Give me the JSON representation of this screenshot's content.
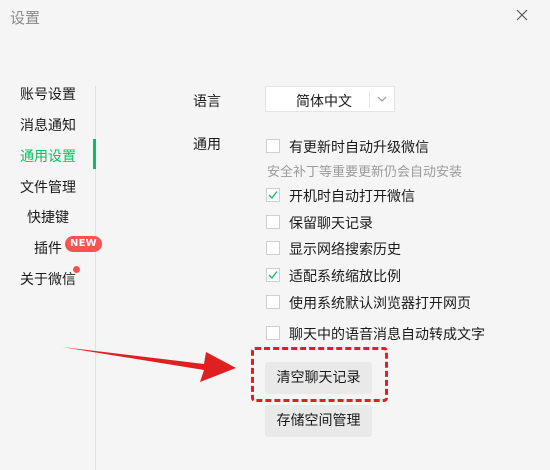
{
  "window": {
    "title": "设置"
  },
  "sidebar": {
    "items": [
      {
        "label": "账号设置"
      },
      {
        "label": "消息通知"
      },
      {
        "label": "通用设置"
      },
      {
        "label": "文件管理"
      },
      {
        "label": "快捷键"
      },
      {
        "label": "插件",
        "badge": "NEW"
      },
      {
        "label": "关于微信"
      }
    ]
  },
  "language": {
    "label": "语言",
    "value": "简体中文"
  },
  "general": {
    "label": "通用",
    "options": [
      {
        "label": "有更新时自动升级微信",
        "checked": false
      },
      {
        "label": "开机时自动打开微信",
        "checked": true
      },
      {
        "label": "保留聊天记录",
        "checked": false
      },
      {
        "label": "显示网络搜索历史",
        "checked": false
      },
      {
        "label": "适配系统缩放比例",
        "checked": true
      },
      {
        "label": "使用系统默认浏览器打开网页",
        "checked": false
      },
      {
        "label": "聊天中的语音消息自动转成文字",
        "checked": false
      }
    ],
    "hint": "安全补丁等重要更新仍会自动安装"
  },
  "buttons": {
    "clear_chat": "清空聊天记录",
    "storage": "存储空间管理"
  },
  "colors": {
    "accent": "#07c160",
    "annotation": "#e02020",
    "badge": "#fa5151"
  }
}
